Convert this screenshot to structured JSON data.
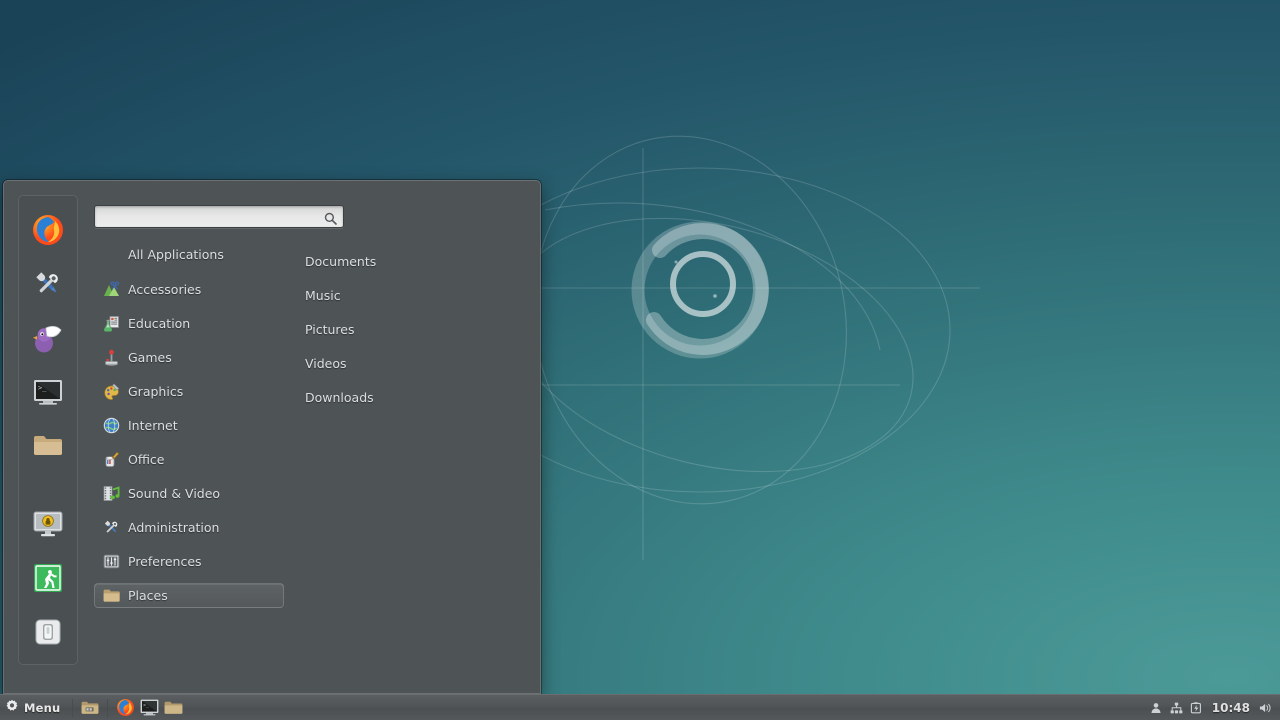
{
  "desktop": {
    "wallpaper_name": "debian-spiral-wallpaper",
    "gradient_top_left": "#2a6068",
    "gradient_top_right": "#1d4a5c",
    "gradient_bottom_right": "#4c9a98"
  },
  "menu": {
    "panel_bg": "#4e5356",
    "search": {
      "value": "",
      "placeholder": ""
    },
    "categories": [
      {
        "label": "All Applications",
        "icon": "",
        "selected": false,
        "header": true
      },
      {
        "label": "Accessories",
        "icon": "accessories-icon",
        "selected": false
      },
      {
        "label": "Education",
        "icon": "education-icon",
        "selected": false
      },
      {
        "label": "Games",
        "icon": "games-icon",
        "selected": false
      },
      {
        "label": "Graphics",
        "icon": "graphics-icon",
        "selected": false
      },
      {
        "label": "Internet",
        "icon": "internet-icon",
        "selected": false
      },
      {
        "label": "Office",
        "icon": "office-icon",
        "selected": false
      },
      {
        "label": "Sound & Video",
        "icon": "sound-video-icon",
        "selected": false
      },
      {
        "label": "Administration",
        "icon": "administration-icon",
        "selected": false
      },
      {
        "label": "Preferences",
        "icon": "preferences-icon",
        "selected": false
      },
      {
        "label": "Places",
        "icon": "places-folder-icon",
        "selected": true
      }
    ],
    "places": [
      {
        "label": "Documents"
      },
      {
        "label": "Music"
      },
      {
        "label": "Pictures"
      },
      {
        "label": "Videos"
      },
      {
        "label": "Downloads"
      }
    ],
    "rail": [
      {
        "name": "firefox-icon"
      },
      {
        "name": "settings-tools-icon"
      },
      {
        "name": "pidgin-icon"
      },
      {
        "name": "terminal-icon"
      },
      {
        "name": "file-manager-icon"
      },
      {
        "name": "lock-screen-icon"
      },
      {
        "name": "log-out-icon"
      },
      {
        "name": "shutdown-icon"
      }
    ]
  },
  "panel": {
    "menu_button_label": "Menu",
    "launchers": [
      {
        "name": "show-desktop-icon"
      },
      {
        "name": "firefox-launcher-icon"
      },
      {
        "name": "terminal-launcher-icon"
      },
      {
        "name": "file-manager-launcher-icon"
      }
    ],
    "tray": [
      {
        "name": "user-status-icon"
      },
      {
        "name": "network-icon"
      },
      {
        "name": "battery-icon"
      }
    ],
    "clock": "10:48",
    "volume_icon": "volume-icon"
  }
}
